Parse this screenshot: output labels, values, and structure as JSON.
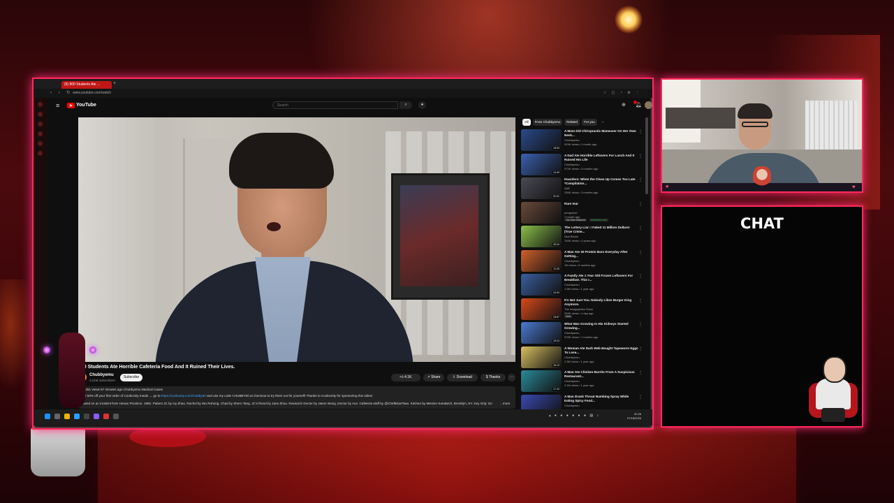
{
  "browser": {
    "tab_title": "(9) 800 Students Ate ...",
    "url": "www.youtube.com/watch"
  },
  "youtube": {
    "logo": "YouTube",
    "search_placeholder": "Search",
    "video": {
      "title": "800 Students Ate Horrible Cafeteria Food And It Ruined Their Lives.",
      "channel": "Chubbyemu",
      "subscribers": "3.21M subscribers",
      "subscribe_label": "Subscribe",
      "likes": "4.1K",
      "share_label": "Share",
      "download_label": "Download",
      "thanks_label": "Thanks",
      "desc_meta": "96,451 views  57 minutes ago  Chubbyemu Medical Cases",
      "desc_line1_pre": "Get 50% off your first order of CookUnity meals → go to",
      "desc_line1_link": "https://cookunity.com/chubby50",
      "desc_line1_post": "and use my code CHUBBY50 at checkout to try them out for yourself! Thanks to CookUnity for sponsoring this video!",
      "desc_line2": "Based on an incident from Henan Province, 1992. Patient JC by Ivy Zhao. Rachel by Wu Ruhong. Chad by Shero Tang. JC's friend by Jane Zhou. Research Doctor by Jason Wong. Doctor by Ace. Cafeteria staff by @ChefBrianTsao. Kitchen by Mission Sandwich, Brooklyn, NY. Key Grip: Do",
      "desc_more": "...more"
    },
    "chips": [
      "All",
      "From Chubbyemu",
      "Related",
      "For you"
    ],
    "recommendations": [
      {
        "title": "A Mom Did Chiropractic Maneuver On Her Own Neck...",
        "channel": "Chubbyemu",
        "meta": "529K views • 1 month ago",
        "duration": "18:54",
        "thumb": "#2a4a8c"
      },
      {
        "title": "A Dad Ate Horrible Leftovers For Lunch And It Ruined His Life",
        "channel": "Chubbyemu",
        "meta": "972K views • 3 months ago",
        "duration": "14:49",
        "thumb": "#3a60b0"
      },
      {
        "title": "Hoarders: When the Clean Up Comes Too Late *Compilation...",
        "channel": "A&E",
        "meta": "336K views • 3 months ago",
        "duration": "51:01",
        "thumb": "#4a4a55"
      },
      {
        "title": "Rare tear",
        "channel": "penguinz0",
        "meta": "1 month ago",
        "duration": "",
        "badge": "YouTube featured",
        "badge2": "Members only",
        "thumb": "#6a4a3a"
      },
      {
        "title": "The Lottery Liar: I Faked 11 Million Dollars! (True Crime...",
        "channel": "Nick Bricks",
        "meta": "764K views • 2 years ago",
        "duration": "40:04",
        "thumb": "#8ac04a"
      },
      {
        "title": "A Man Ate 30 Protein Bars Everyday After Getting...",
        "channel": "Chubbyemu",
        "meta": "1M views • 5 months ago",
        "duration": "11:25",
        "thumb": "#d0602a"
      },
      {
        "title": "A Family Ate 1 Year Old Frozen Leftovers For Breakfast. This I...",
        "channel": "Chubbyemu",
        "meta": "1.5M views • 1 year ago",
        "duration": "24:34",
        "thumb": "#3a5fa0"
      },
      {
        "title": "It's Not Just You. Nobody Likes Burger King Anymore.",
        "channel": "The Infographics Show",
        "meta": "539K views • 1 day ago",
        "duration": "15:57",
        "badge": "New",
        "thumb": "#d84a1a"
      },
      {
        "title": "What Was Growing In His Kidneys Started Growing...",
        "channel": "Chubbyemu",
        "meta": "976K views • 7 months ago",
        "duration": "19:24",
        "thumb": "#4a7ad0"
      },
      {
        "title": "A Woman Ate Dark Web Bought Tapeworm Eggs To Lose...",
        "channel": "Chubbyemu",
        "meta": "2.3M views • 1 year ago",
        "duration": "16:13",
        "thumb": "#d8c060"
      },
      {
        "title": "A Man Ate Chicken Burrito From A Suspicious Restaurant...",
        "channel": "Chubbyemu",
        "meta": "3.1M views • 1 year ago",
        "duration": "17:43",
        "thumb": "#2a8a9a"
      },
      {
        "title": "A Man Drank Throat Numbing Spray While Eating Spicy Food...",
        "channel": "Chubbyemu",
        "meta": "",
        "duration": "",
        "thumb": "#3a4ab0"
      }
    ]
  },
  "taskbar": {
    "clock_time": "00:28",
    "clock_date": "07/18/2025"
  },
  "overlay": {
    "chat_title": "CHAT",
    "accent": "#ff2a5a"
  }
}
